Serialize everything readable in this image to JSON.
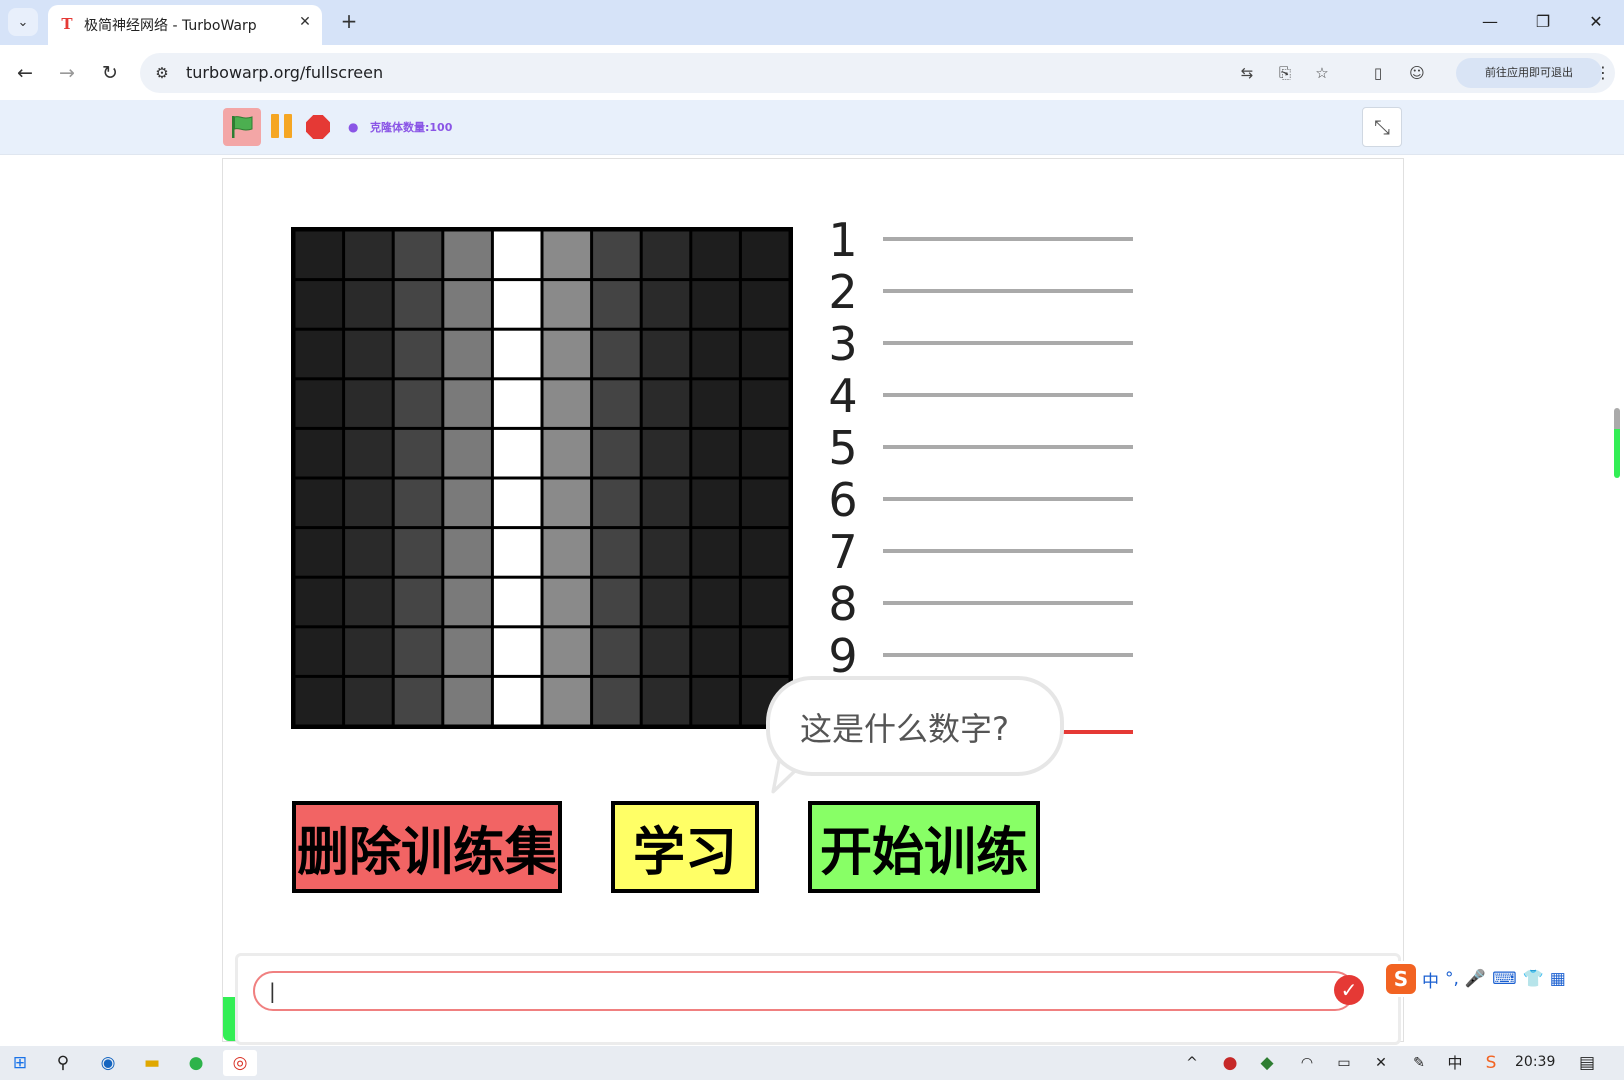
{
  "browser": {
    "tab_title": "极简神经网络 - TurboWarp",
    "tab_favicon": "T",
    "url": "turbowarp.org/fullscreen",
    "profile_text": "前往应用即可退出"
  },
  "turbowarp": {
    "clone_count_label": "克隆体数量:100"
  },
  "stage": {
    "digit_labels": [
      "1",
      "2",
      "3",
      "4",
      "5",
      "6",
      "7",
      "8",
      "9"
    ],
    "speech_bubble": "这是什么数字?",
    "buttons": {
      "delete_training_set": "删除训练集",
      "learn": "学习",
      "start_training": "开始训练"
    },
    "button_colors": {
      "delete_training_set": "#f26464",
      "learn": "#ffff66",
      "start_training": "#88ff66"
    },
    "grid": {
      "rows": 10,
      "columns": 10,
      "column_grays": [
        "#1e1e1e",
        "#2a2a2a",
        "#454545",
        "#7a7a7a",
        "#ffffff",
        "#8a8a8a",
        "#444444",
        "#2a2a2a",
        "#1e1e1e",
        "#1c1c1c"
      ]
    },
    "answer_input": {
      "value": "|"
    }
  },
  "ime": {
    "mode_label": "中"
  },
  "taskbar": {
    "ime_indicator": "中",
    "clock": "20:39"
  }
}
